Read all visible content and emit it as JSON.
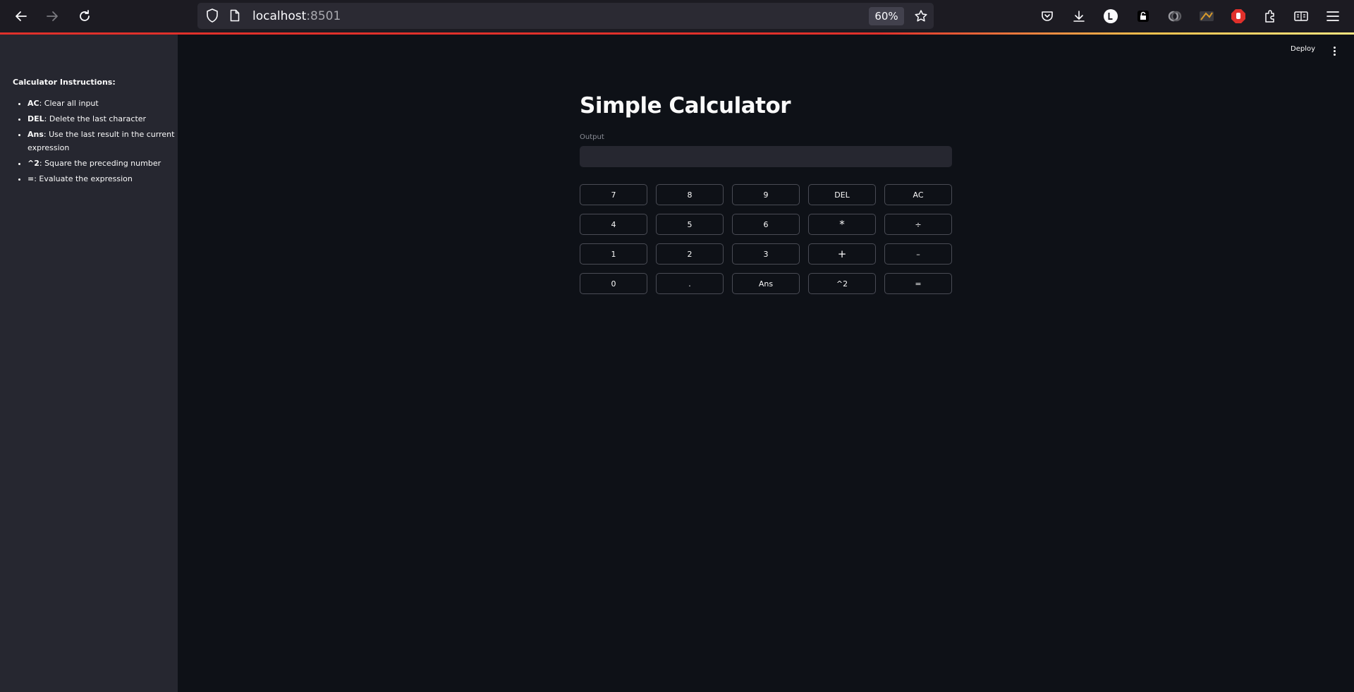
{
  "browser": {
    "url_host": "localhost",
    "url_port": ":8501",
    "zoom": "60%"
  },
  "sidebar": {
    "heading": "Calculator Instructions:",
    "items": [
      {
        "key": "AC",
        "text": ": Clear all input"
      },
      {
        "key": "DEL",
        "text": ": Delete the last character"
      },
      {
        "key": "Ans",
        "text": ": Use the last result in the current expression"
      },
      {
        "key": "^2",
        "text": ": Square the preceding number"
      },
      {
        "key": "=",
        "text": ": Evaluate the expression"
      }
    ]
  },
  "header": {
    "deploy_label": "Deploy"
  },
  "main": {
    "title": "Simple Calculator",
    "output_label": "Output",
    "output_value": "",
    "keys": [
      [
        "7",
        "8",
        "9",
        "DEL",
        "AC"
      ],
      [
        "4",
        "5",
        "6",
        "*",
        "÷"
      ],
      [
        "1",
        "2",
        "3",
        "+",
        "–"
      ],
      [
        "0",
        ".",
        "Ans",
        "^2",
        "="
      ]
    ]
  },
  "colors": {
    "background": "#0e1117",
    "sidebar": "#262730",
    "input_bg": "#262730",
    "button_border": "#4a4c55",
    "text": "#fafafa"
  }
}
